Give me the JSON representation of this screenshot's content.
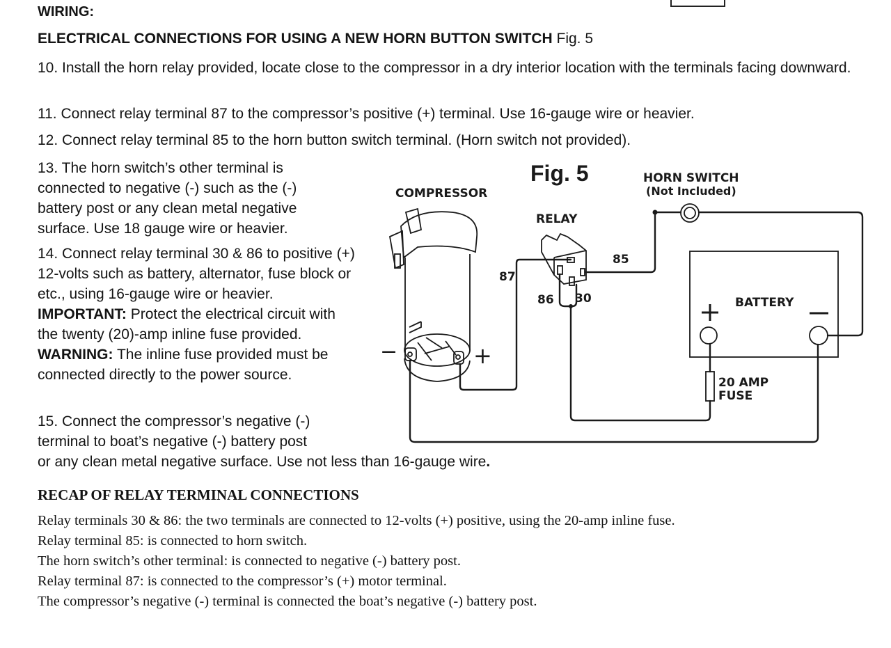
{
  "header": {
    "section_title": "WIRING:",
    "subtitle_bold": "ELECTRICAL CONNECTIONS FOR USING A NEW HORN BUTTON SWITCH",
    "subtitle_ref": "Fig. 5"
  },
  "steps": {
    "s10": "10. Install the horn relay provided, locate close to the compressor in a dry interior location with the terminals facing downward.",
    "s11": "11. Connect relay terminal 87 to the compressor’s positive (+) terminal. Use 16-gauge wire or heavier.",
    "s12": "12. Connect relay terminal 85 to the horn button switch terminal. (Horn switch not provided).",
    "s13": "13. The horn switch’s other terminal is connected to negative (-) such as the (-) battery post or any clean metal negative surface. Use 18 gauge wire or heavier.",
    "s14_a": "14. Connect relay terminal 30 & 86 to positive (+) 12-volts such as battery, alternator, fuse block or etc., using 16-gauge wire or heavier.",
    "s14_important_label": "IMPORTANT:",
    "s14_b": "Protect the electrical circuit with the twenty (20)-amp inline fuse provided.",
    "s14_warning_label": "WARNING:",
    "s14_c": "The inline fuse provided must be connected directly to the power source.",
    "s15_a": "15. Connect the compressor’s negative (-) terminal to boat’s negative (-) battery post",
    "s15_b": "or any clean metal negative surface. Use not less than 16-gauge wire",
    "s15_end": "."
  },
  "figure": {
    "title": "Fig. 5",
    "compressor_label": "COMPRESSOR",
    "relay_label": "RELAY",
    "horn_switch_label": "HORN SWITCH",
    "horn_switch_note": "(Not Included)",
    "battery_label": "BATTERY",
    "fuse_label_1": "20 AMP",
    "fuse_label_2": "FUSE",
    "terminal_87": "87",
    "terminal_85": "85",
    "terminal_86": "86",
    "terminal_30": "30",
    "plus_sign": "+",
    "minus_sign": "−"
  },
  "recap": {
    "title": "RECAP OF RELAY TERMINAL CONNECTIONS",
    "lines": [
      "Relay terminals 30 & 86: the two terminals are connected to 12-volts (+) positive, using the 20-amp inline fuse.",
      "Relay terminal 85: is connected to horn switch.",
      "The horn switch’s other terminal: is connected to negative (-) battery post.",
      "Relay terminal 87: is connected to the compressor’s (+) motor terminal.",
      "The compressor’s negative (-) terminal is connected the boat’s negative (-) battery post."
    ]
  }
}
